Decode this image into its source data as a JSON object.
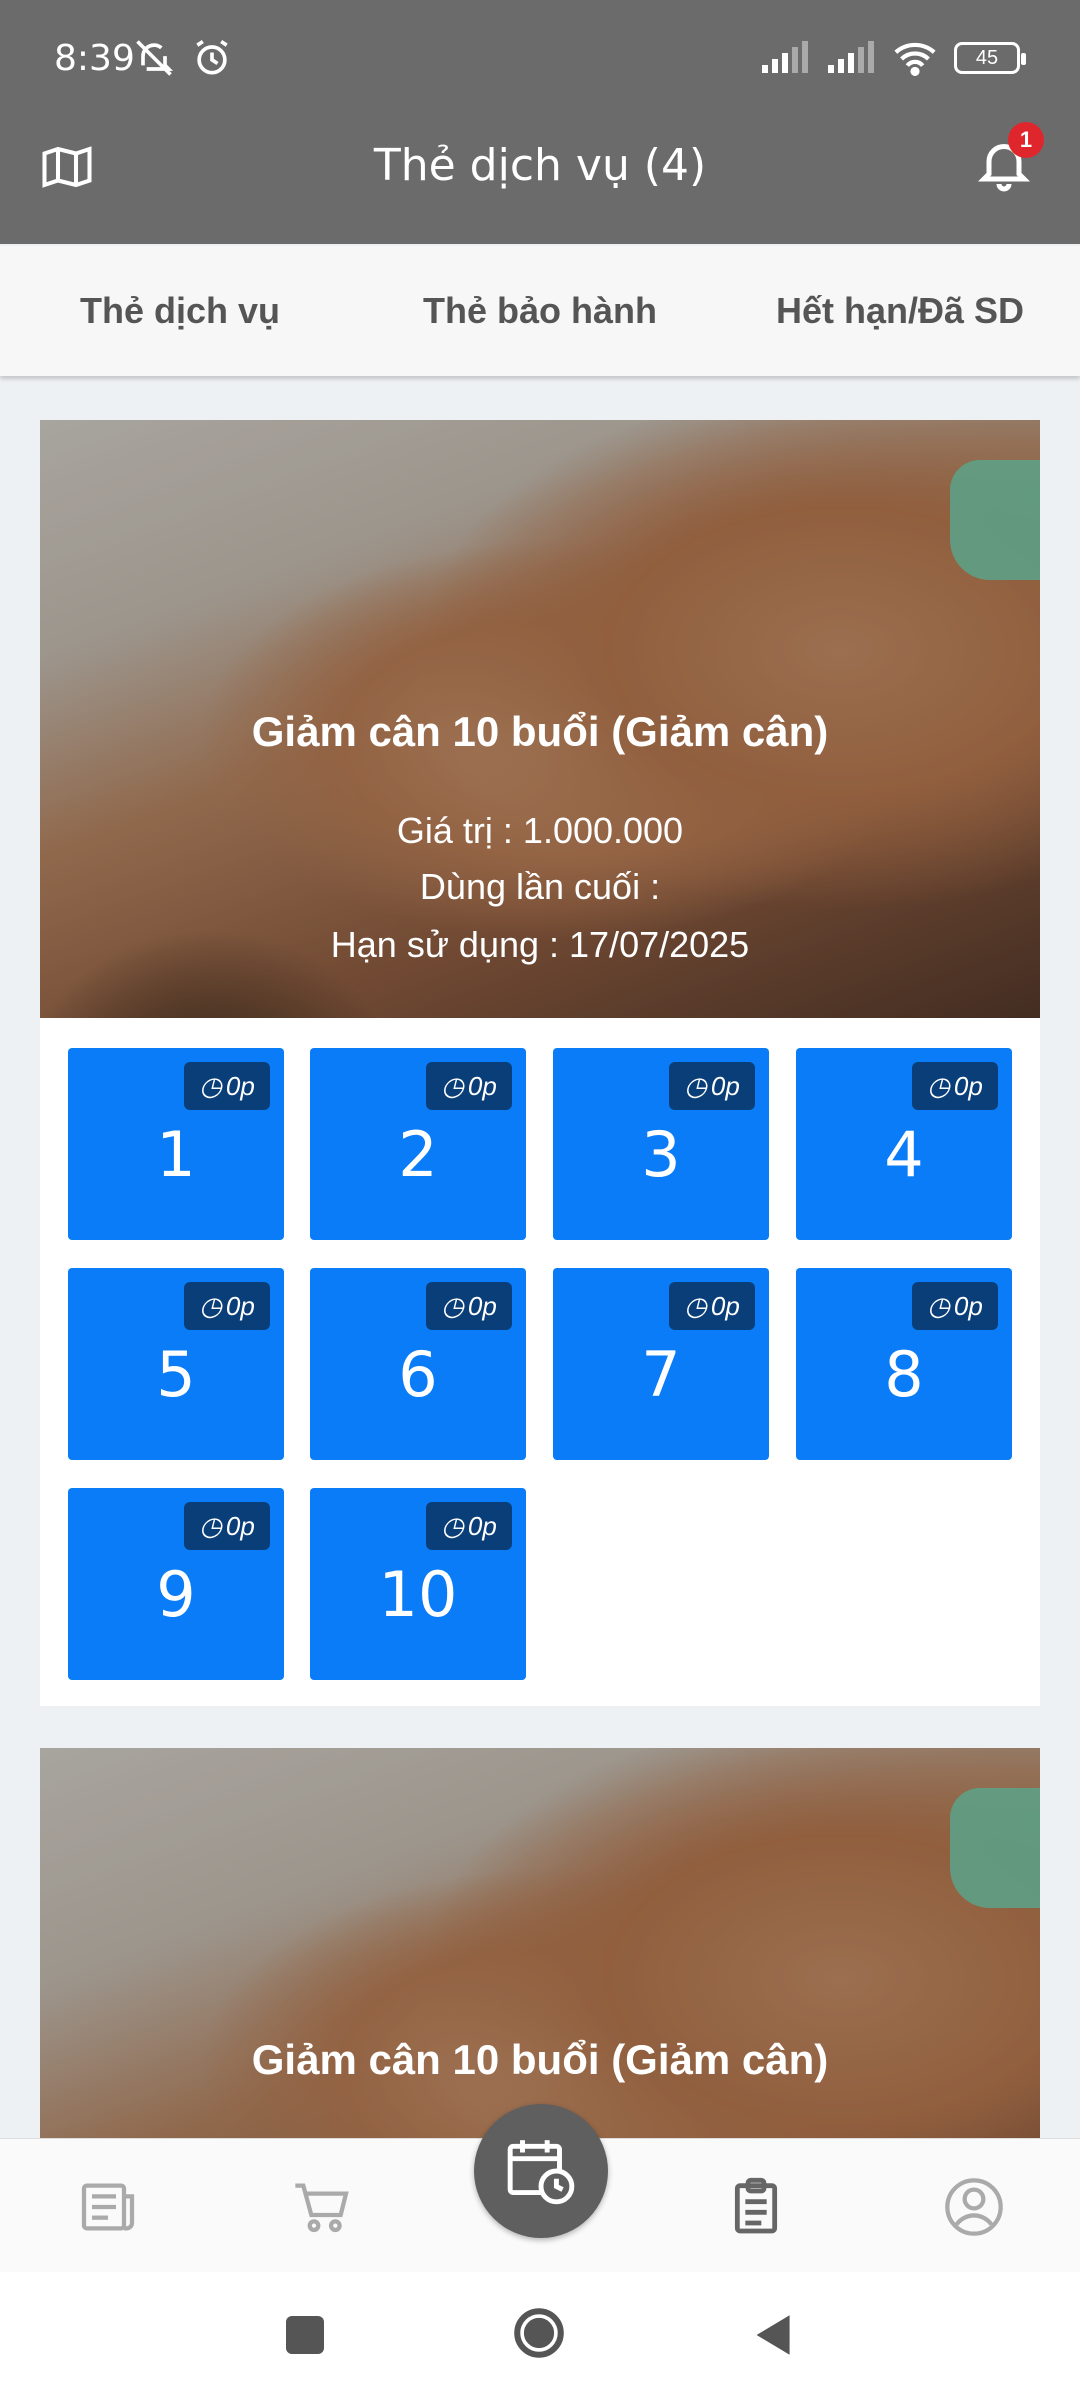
{
  "status": {
    "time": "8:39",
    "battery": "45"
  },
  "header": {
    "title": "Thẻ dịch vụ (4)",
    "notification_count": "1"
  },
  "tabs": [
    {
      "label": "Thẻ dịch vụ"
    },
    {
      "label": "Thẻ bảo hành"
    },
    {
      "label": "Hết hạn/Đã SD"
    }
  ],
  "cards": [
    {
      "title": "Giảm cân 10 buổi (Giảm cân)",
      "value_line": "Giá trị : 1.000.000",
      "last_used_line": "Dùng lần cuối :",
      "expiry_line": "Hạn sử dụng : 17/07/2025",
      "sessions": [
        {
          "num": "1",
          "time": "0p"
        },
        {
          "num": "2",
          "time": "0p"
        },
        {
          "num": "3",
          "time": "0p"
        },
        {
          "num": "4",
          "time": "0p"
        },
        {
          "num": "5",
          "time": "0p"
        },
        {
          "num": "6",
          "time": "0p"
        },
        {
          "num": "7",
          "time": "0p"
        },
        {
          "num": "8",
          "time": "0p"
        },
        {
          "num": "9",
          "time": "0p"
        },
        {
          "num": "10",
          "time": "0p"
        }
      ]
    },
    {
      "title": "Giảm cân 10 buổi (Giảm cân)"
    }
  ],
  "colors": {
    "header_bg": "#6b6b6b",
    "tile_bg": "#0a7cf7",
    "pill_bg": "#0a3e78",
    "badge": "#e0262d"
  },
  "bottom_nav": [
    "news-icon",
    "cart-icon",
    "calendar-clock-icon",
    "clipboard-icon",
    "account-icon"
  ]
}
